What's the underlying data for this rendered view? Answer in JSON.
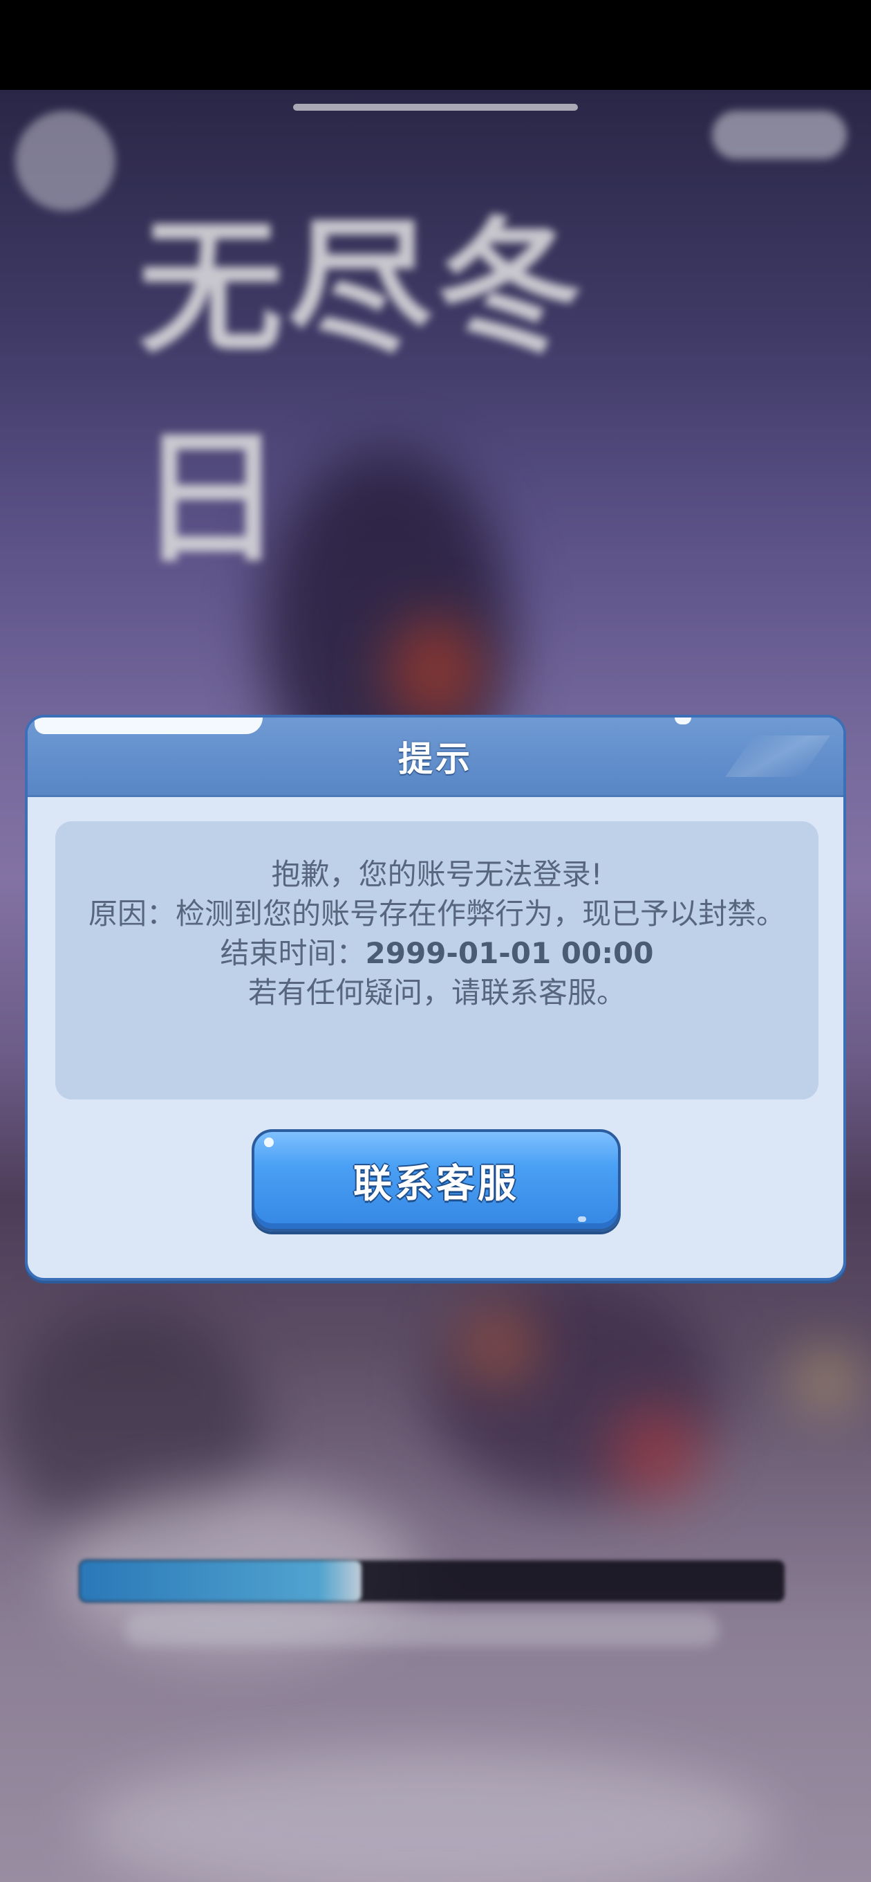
{
  "background": {
    "game_logo": "无尽冬日",
    "loading_progress": 0.4
  },
  "dialog": {
    "title": "提示",
    "message": {
      "line1": "抱歉，您的账号无法登录!",
      "line2": "原因：检测到您的账号存在作弊行为，现已予以封禁。",
      "end_time_label": "结束时间：",
      "end_time_value": "2999-01-01 00:00",
      "line4": "若有任何疑问，请联系客服。"
    },
    "contact_button": "联系客服"
  },
  "colors": {
    "header_blue": "#5886c6",
    "dialog_bg": "#dbe6f6",
    "message_bg": "#bfd0e9",
    "button_blue": "#4aa0f4",
    "text_gray": "#57667c"
  }
}
